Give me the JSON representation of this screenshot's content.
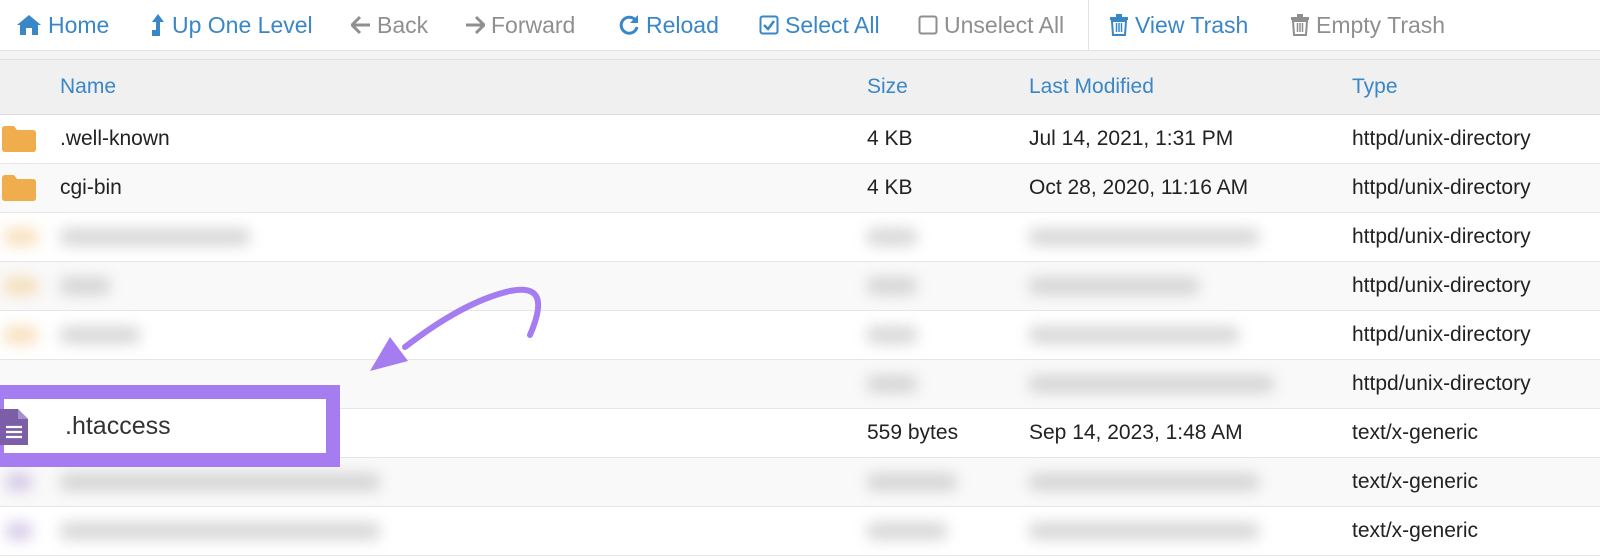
{
  "toolbar": {
    "home": "Home",
    "up_one_level": "Up One Level",
    "back": "Back",
    "forward": "Forward",
    "reload": "Reload",
    "select_all": "Select All",
    "unselect_all": "Unselect All",
    "view_trash": "View Trash",
    "empty_trash": "Empty Trash"
  },
  "columns": {
    "name": "Name",
    "size": "Size",
    "last_modified": "Last Modified",
    "type": "Type"
  },
  "rows": [
    {
      "name": ".well-known",
      "size": "4 KB",
      "modified": "Jul 14, 2021, 1:31 PM",
      "type": "httpd/unix-directory",
      "icon": "folder-icon"
    },
    {
      "name": "cgi-bin",
      "size": "4 KB",
      "modified": "Oct 28, 2020, 11:16 AM",
      "type": "httpd/unix-directory",
      "icon": "folder-icon"
    },
    {
      "type": "httpd/unix-directory",
      "icon": "folder-icon"
    },
    {
      "type": "httpd/unix-directory",
      "icon": "folder-icon"
    },
    {
      "type": "httpd/unix-directory",
      "icon": "folder-icon"
    },
    {
      "type": "httpd/unix-directory",
      "icon": "folder-icon"
    },
    {
      "name": ".htaccess",
      "size": "559 bytes",
      "modified": "Sep 14, 2023, 1:48 AM",
      "type": "text/x-generic",
      "icon": "file-text-icon"
    },
    {
      "type": "text/x-generic",
      "icon": "file-text-icon"
    },
    {
      "type": "text/x-generic",
      "icon": "file-text-icon"
    }
  ],
  "colors": {
    "accent_blue": "#3a87c8",
    "disabled_gray": "#8f8f8f",
    "folder_orange": "#f0ad4e",
    "file_purple": "#7b5ea7",
    "highlight_purple": "#a57df0"
  }
}
